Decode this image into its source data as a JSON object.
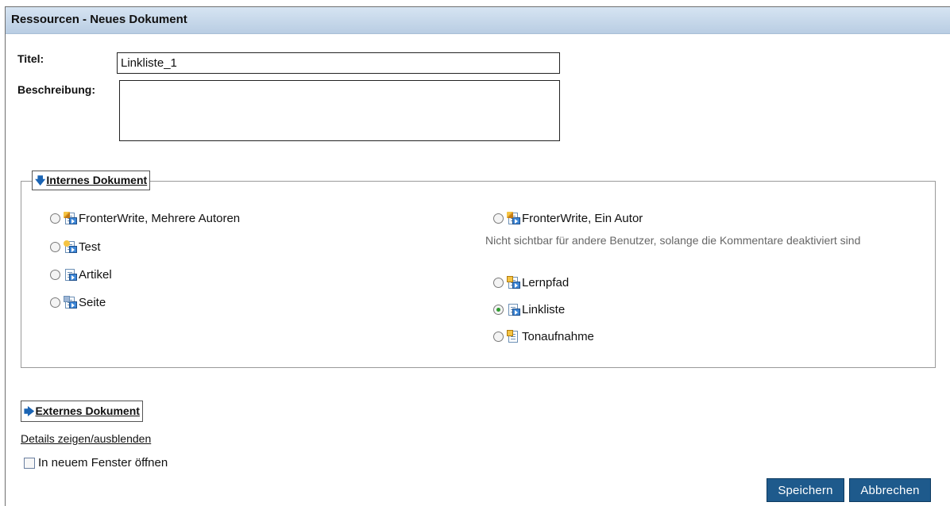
{
  "header": {
    "title": "Ressourcen - Neues Dokument"
  },
  "form": {
    "title_label": "Titel:",
    "title_value": "Linkliste_1",
    "description_label": "Beschreibung:",
    "description_value": ""
  },
  "internal": {
    "legend": "Internes Dokument",
    "left_options": [
      {
        "label": "FronterWrite, Mehrere Autoren",
        "icon": "fronterwrite-multi-icon",
        "selected": false
      },
      {
        "label": "Test",
        "icon": "test-icon",
        "selected": false
      },
      {
        "label": "Artikel",
        "icon": "article-icon",
        "selected": false
      },
      {
        "label": "Seite",
        "icon": "page-icon",
        "selected": false
      }
    ],
    "right_options": [
      {
        "label": "FronterWrite, Ein Autor",
        "icon": "fronterwrite-single-icon",
        "selected": false
      },
      {
        "label": "Lernpfad",
        "icon": "learning-path-icon",
        "selected": false
      },
      {
        "label": "Linkliste",
        "icon": "link-list-icon",
        "selected": true
      },
      {
        "label": "Tonaufnahme",
        "icon": "audio-recording-icon",
        "selected": false
      }
    ],
    "note": "Nicht sichtbar für andere Benutzer, solange die Kommentare deaktiviert sind"
  },
  "external": {
    "legend": "Externes Dokument",
    "details_link": "Details zeigen/ausblenden",
    "new_window_label": "In neuem Fenster öffnen",
    "new_window_checked": false
  },
  "buttons": {
    "save": "Speichern",
    "cancel": "Abbrechen"
  },
  "colors": {
    "header_bg": "#c8d9ec",
    "button_bg": "#1e5a8c",
    "radio_selected": "#2f9b2f"
  }
}
